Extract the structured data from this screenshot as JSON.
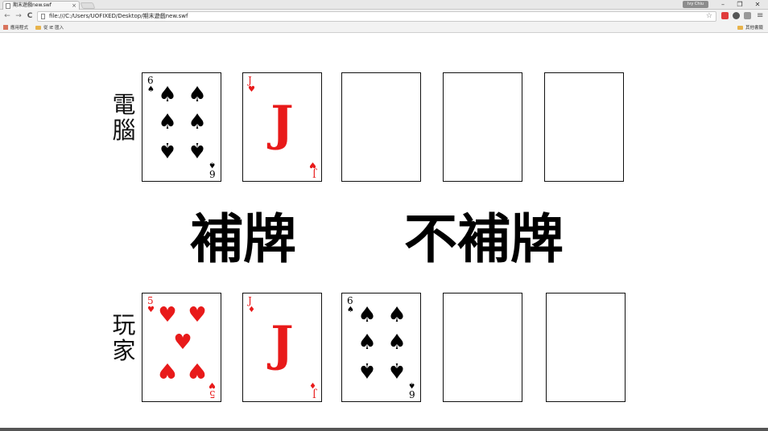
{
  "browser": {
    "tab_title": "期末遊戲new.swf",
    "tab_close": "×",
    "user_badge": "Ivy Chiu",
    "url": "file:///C:/Users/UOFIXED/Desktop/期末遊戲new.swf",
    "bookmarks": {
      "apps": "應用程式",
      "recent": "從 IE 匯入",
      "other": "其他書籤"
    },
    "window_controls": {
      "minimize": "–",
      "restore": "❐",
      "close": "✕"
    },
    "nav": {
      "back": "←",
      "forward": "→",
      "reload": "C",
      "star": "☆",
      "menu": "≡"
    }
  },
  "game": {
    "computer_label": "電腦",
    "player_label": "玩家",
    "hit_button": "補牌",
    "stand_button": "不補牌",
    "computer_cards": [
      {
        "rank": "6",
        "suit": "♠",
        "color": "#000000"
      },
      {
        "rank": "J",
        "suit": "♥",
        "color": "#e81a1a"
      },
      null,
      null,
      null
    ],
    "player_cards": [
      {
        "rank": "5",
        "suit": "♥",
        "color": "#e81a1a"
      },
      {
        "rank": "J",
        "suit": "♦",
        "color": "#e81a1a"
      },
      {
        "rank": "6",
        "suit": "♠",
        "color": "#000000"
      },
      null,
      null
    ]
  }
}
